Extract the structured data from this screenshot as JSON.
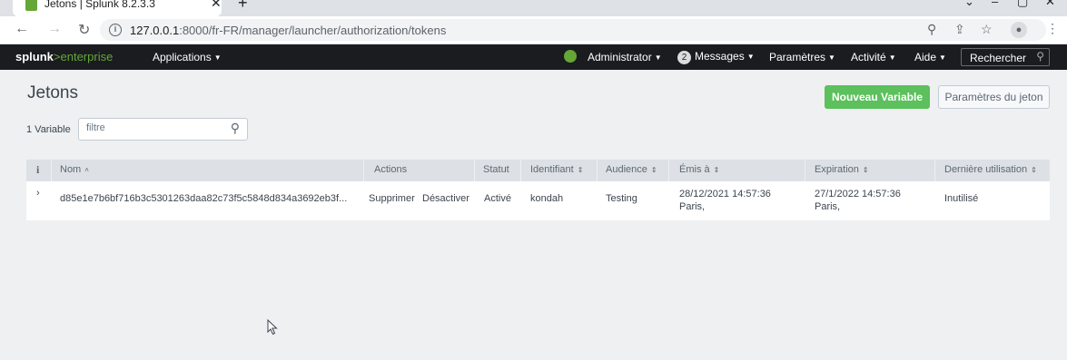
{
  "browser": {
    "tab_title": "Jetons | Splunk 8.2.3.3",
    "url_host": "127.0.0.1",
    "url_rest": ":8000/fr-FR/manager/launcher/authorization/tokens"
  },
  "nav": {
    "logo_bold": "splunk",
    "logo_gt": ">",
    "logo_light": "enterprise",
    "apps": "Applications",
    "admin": "Administrator",
    "messages_count": "2",
    "messages": "Messages",
    "settings": "Paramètres",
    "activity": "Activité",
    "help": "Aide",
    "search": "Rechercher"
  },
  "page": {
    "title": "Jetons",
    "new_button": "Nouveau Variable",
    "settings_button": "Paramètres du jeton",
    "count": "1 Variable",
    "filter_placeholder": "filtre"
  },
  "table": {
    "headers": {
      "info": "i",
      "name": "Nom",
      "actions": "Actions",
      "status": "Statut",
      "id": "Identifiant",
      "audience": "Audience",
      "issued": "Émis à",
      "expiration": "Expiration",
      "last_used": "Dernière utilisation"
    },
    "rows": [
      {
        "name": "d85e1e7b6bf716b3c5301263daa82c73f5c5848d834a3692eb3f...",
        "delete": "Supprimer",
        "disable": "Désactiver",
        "status": "Activé",
        "id": "kondah",
        "audience": "Testing",
        "issued_date": "28/12/2021 14:57:36",
        "issued_tz": "Paris,",
        "exp_date": "27/1/2022 14:57:36",
        "exp_tz": "Paris,",
        "last_used": "Inutilisé"
      }
    ]
  }
}
